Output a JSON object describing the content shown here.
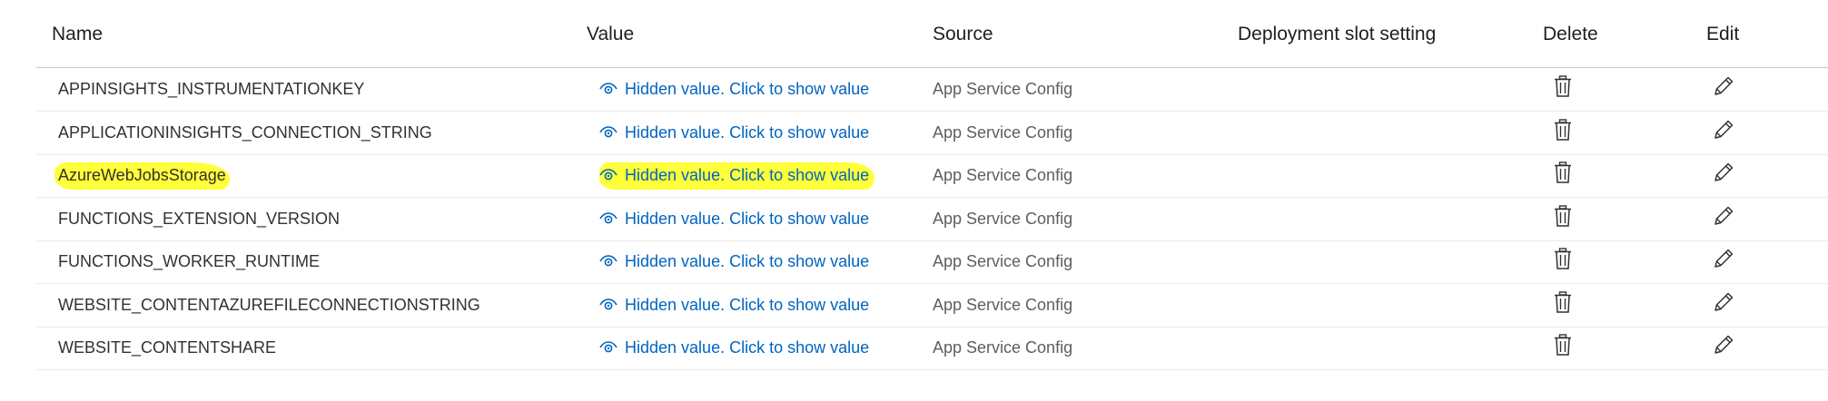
{
  "columns": {
    "name": "Name",
    "value": "Value",
    "source": "Source",
    "slot": "Deployment slot setting",
    "delete": "Delete",
    "edit": "Edit"
  },
  "rows": [
    {
      "name": "APPINSIGHTS_INSTRUMENTATIONKEY",
      "value": "Hidden value. Click to show value",
      "source": "App Service Config",
      "highlighted": false
    },
    {
      "name": "APPLICATIONINSIGHTS_CONNECTION_STRING",
      "value": "Hidden value. Click to show value",
      "source": "App Service Config",
      "highlighted": false
    },
    {
      "name": "AzureWebJobsStorage",
      "value": "Hidden value. Click to show value",
      "source": "App Service Config",
      "highlighted": true
    },
    {
      "name": "FUNCTIONS_EXTENSION_VERSION",
      "value": "Hidden value. Click to show value",
      "source": "App Service Config",
      "highlighted": false
    },
    {
      "name": "FUNCTIONS_WORKER_RUNTIME",
      "value": "Hidden value. Click to show value",
      "source": "App Service Config",
      "highlighted": false
    },
    {
      "name": "WEBSITE_CONTENTAZUREFILECONNECTIONSTRING",
      "value": "Hidden value. Click to show value",
      "source": "App Service Config",
      "highlighted": false
    },
    {
      "name": "WEBSITE_CONTENTSHARE",
      "value": "Hidden value. Click to show value",
      "source": "App Service Config",
      "highlighted": false
    }
  ],
  "icons": {
    "value": "eye-icon",
    "delete": "trash-icon",
    "edit": "pencil-icon"
  },
  "colors": {
    "link": "#0064bf",
    "highlight": "#ffff3a",
    "source_text": "#605e5c"
  }
}
